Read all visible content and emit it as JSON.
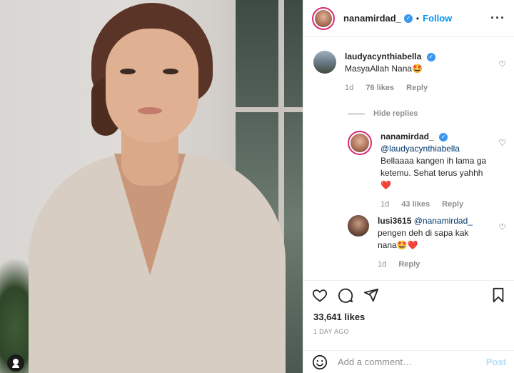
{
  "post": {
    "likes": "33,641 likes",
    "time": "1 DAY AGO"
  },
  "header": {
    "username": "nanamirdad_",
    "follow_label": "Follow",
    "dot": "•",
    "more": "···"
  },
  "comments": [
    {
      "username": "laudyacynthiabella",
      "text": "MasyaAllah Nana🤩",
      "time": "1d",
      "likes": "76 likes",
      "reply": "Reply"
    }
  ],
  "hide_replies": "Hide replies",
  "replies": [
    {
      "username": "nanamirdad_",
      "mention": "@laudyacynthiabella",
      "text": "Bellaaaa kangen ih lama ga ketemu. Sehat terus yahhh",
      "emoji": "❤️",
      "time": "1d",
      "likes": "43 likes",
      "reply": "Reply"
    },
    {
      "username": "lusi3615",
      "mention": "@nanamirdad_",
      "text": "pengen deh di sapa kak nana🤩❤️",
      "time": "1d",
      "reply": "Reply"
    }
  ],
  "add_comment": {
    "placeholder": "Add a comment…",
    "post_label": "Post"
  },
  "colors": {
    "link": "#0095f6",
    "verified": "#3897f0",
    "muted": "#8e8e8e",
    "text": "#262626"
  },
  "icons": [
    "heart-icon",
    "comment-icon",
    "share-icon",
    "bookmark-icon",
    "emoji-icon",
    "more-icon",
    "verified-icon"
  ]
}
